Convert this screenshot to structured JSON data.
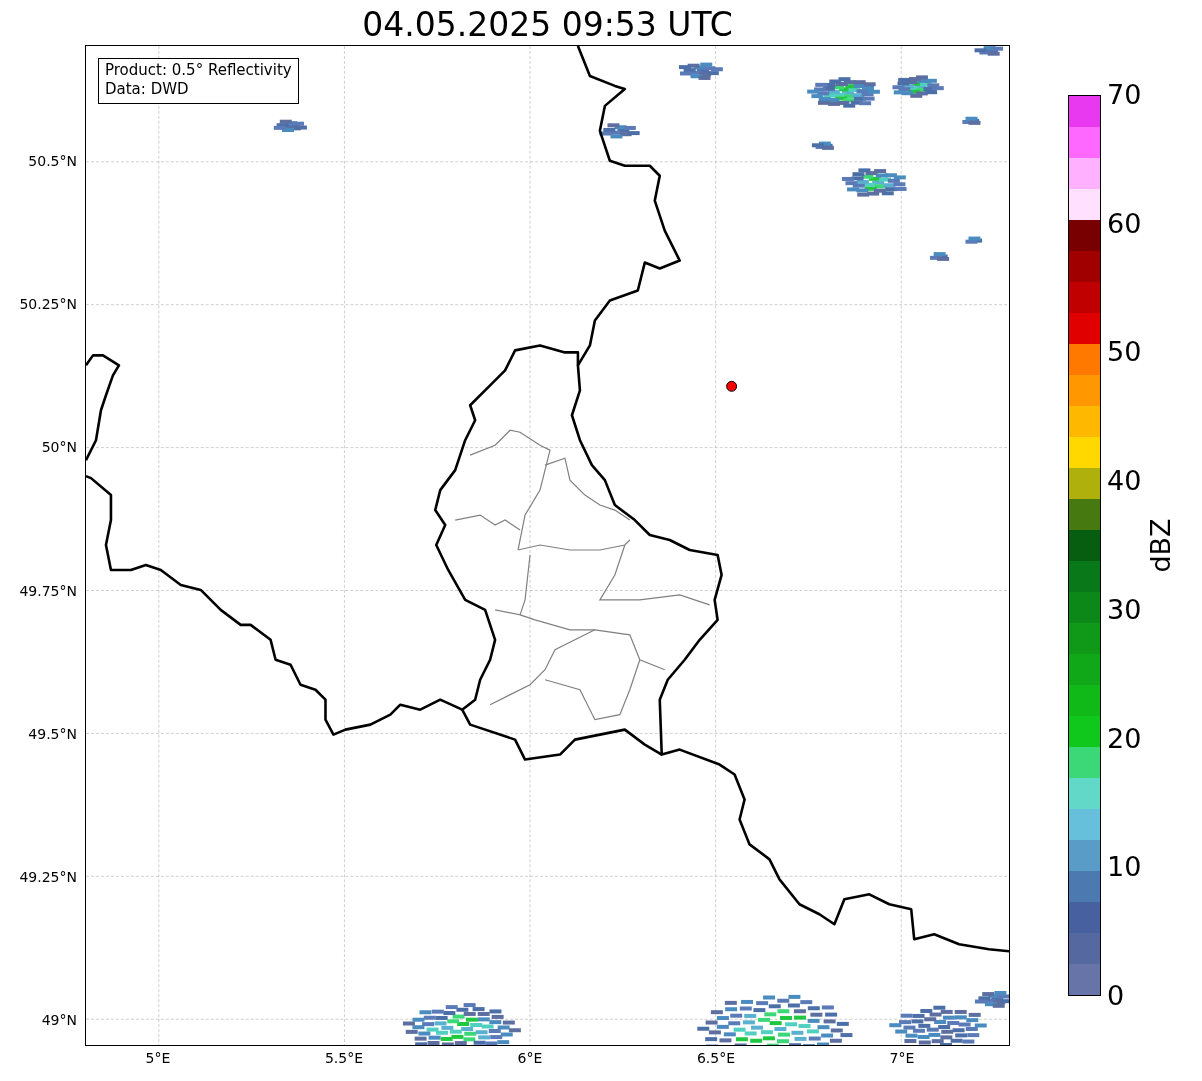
{
  "title": "04.05.2025 09:53 UTC",
  "legend": [
    "Product: 0.5° Reflectivity",
    "Data: DWD"
  ],
  "map": {
    "lat_labels": [
      "50.5°N",
      "50.25°N",
      "50°N",
      "49.75°N",
      "49.5°N",
      "49.25°N",
      "49°N"
    ],
    "lon_labels": [
      "5°E",
      "5.5°E",
      "6°E",
      "6.5°E",
      "7°E"
    ]
  },
  "colorbar": {
    "label": "dBZ",
    "ticks": [
      "70",
      "60",
      "50",
      "40",
      "30",
      "20",
      "10",
      "0"
    ],
    "bands": [
      {
        "color": "#e838f0"
      },
      {
        "color": "#ff68ff"
      },
      {
        "color": "#ffb0ff"
      },
      {
        "color": "#ffe0ff"
      },
      {
        "color": "#780000"
      },
      {
        "color": "#a00000"
      },
      {
        "color": "#c00000"
      },
      {
        "color": "#e00000"
      },
      {
        "color": "#ff7800"
      },
      {
        "color": "#ff9800"
      },
      {
        "color": "#ffb800"
      },
      {
        "color": "#ffd800"
      },
      {
        "color": "#b0b00c"
      },
      {
        "color": "#467a10"
      },
      {
        "color": "#085e10"
      },
      {
        "color": "#087818"
      },
      {
        "color": "#0c8818"
      },
      {
        "color": "#109818"
      },
      {
        "color": "#10a818"
      },
      {
        "color": "#10b818"
      },
      {
        "color": "#10c81c"
      },
      {
        "color": "#3cd878"
      },
      {
        "color": "#62d8c8"
      },
      {
        "color": "#66c0dc"
      },
      {
        "color": "#5a9cc8"
      },
      {
        "color": "#4c7ab0"
      },
      {
        "color": "#4660a0"
      },
      {
        "color": "#5568a0"
      },
      {
        "color": "#6674a8"
      }
    ]
  }
}
